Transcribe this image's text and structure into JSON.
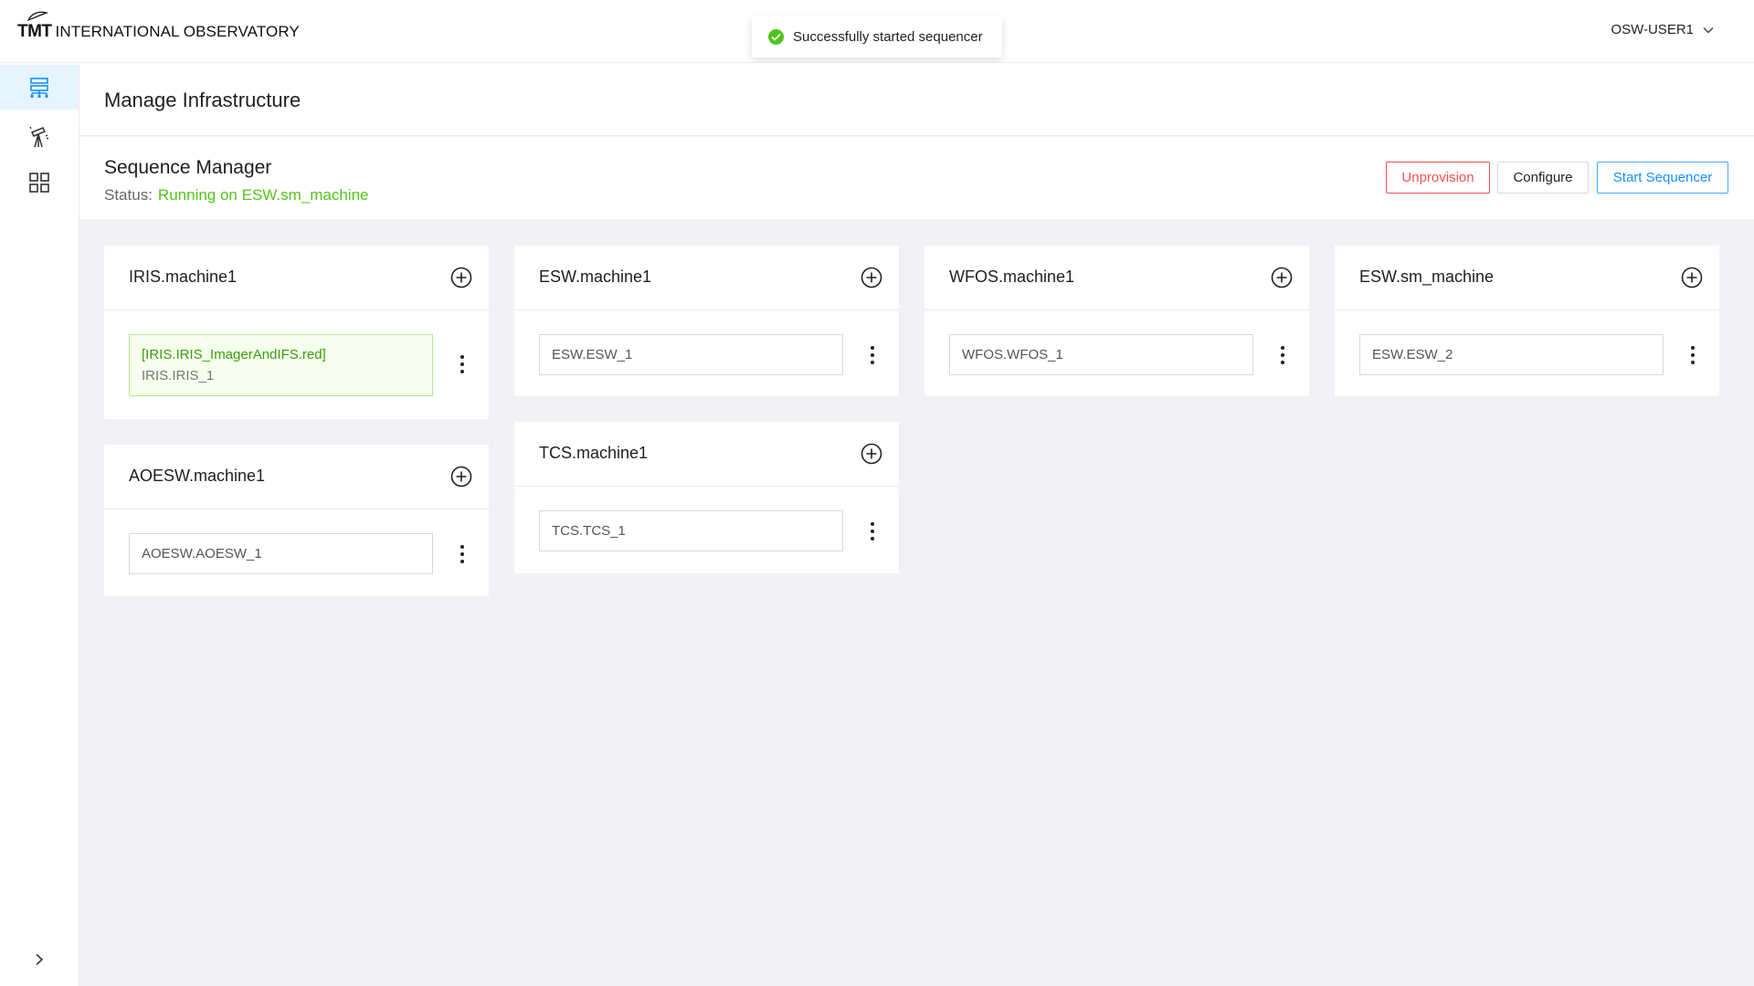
{
  "header": {
    "logo_mark": "TMT",
    "logo_text": "INTERNATIONAL OBSERVATORY",
    "user": "OSW-USER1"
  },
  "toast": {
    "message": "Successfully started sequencer"
  },
  "sidebar": {
    "items": [
      {
        "icon": "infrastructure-icon",
        "active": true
      },
      {
        "icon": "telescope-icon",
        "active": false
      },
      {
        "icon": "grid-icon",
        "active": false
      }
    ]
  },
  "page": {
    "title": "Manage Infrastructure"
  },
  "sequence_manager": {
    "title": "Sequence Manager",
    "status_label": "Status:",
    "status_value": "Running on ESW.sm_machine",
    "buttons": {
      "unprovision": "Unprovision",
      "configure": "Configure",
      "start": "Start Sequencer"
    }
  },
  "machines": [
    {
      "name": "IRIS.machine1",
      "sequencer": "IRIS.IRIS_1",
      "script": "[IRIS.IRIS_ImagerAndIFS.red]"
    },
    {
      "name": "ESW.machine1",
      "sequencer": "ESW.ESW_1"
    },
    {
      "name": "WFOS.machine1",
      "sequencer": "WFOS.WFOS_1"
    },
    {
      "name": "ESW.sm_machine",
      "sequencer": "ESW.ESW_2"
    },
    {
      "name": "AOESW.machine1",
      "sequencer": "AOESW.AOESW_1"
    },
    {
      "name": "TCS.machine1",
      "sequencer": "TCS.TCS_1"
    }
  ]
}
